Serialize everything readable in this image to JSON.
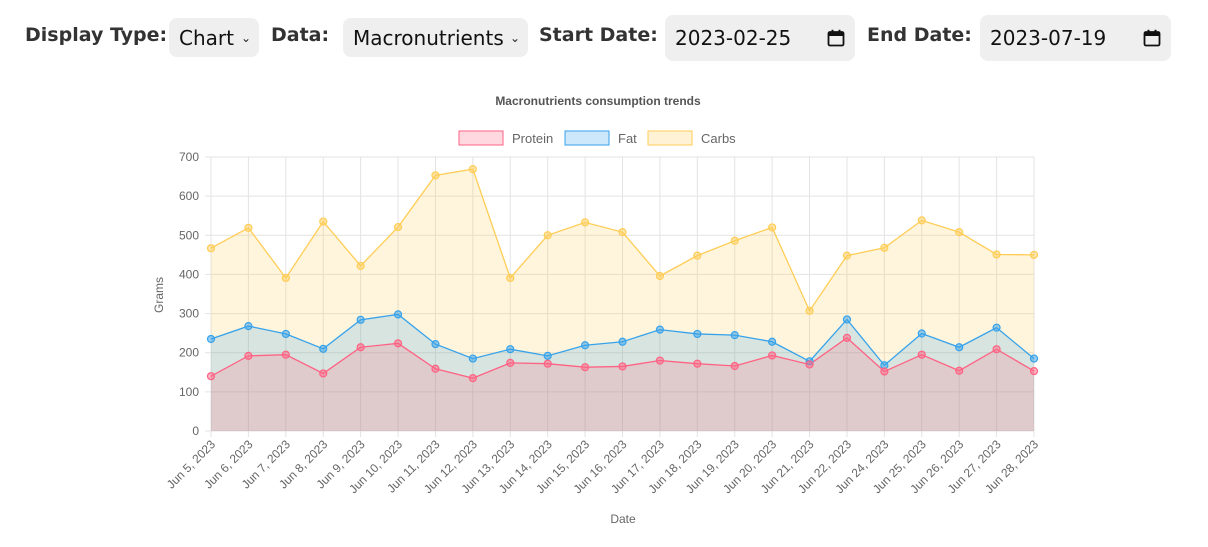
{
  "controls": {
    "display_type_label": "Display Type:",
    "display_type_value": "Chart",
    "data_label": "Data:",
    "data_value": "Macronutrients",
    "start_date_label": "Start Date:",
    "start_date_value": "2023-02-25",
    "end_date_label": "End Date:",
    "end_date_value": "2023-07-19"
  },
  "colors": {
    "protein": "#ff6384",
    "fat": "#36a2eb",
    "carbs": "#ffcd56"
  },
  "chart_data": {
    "type": "area",
    "title": "Macronutrients consumption trends",
    "xlabel": "Date",
    "ylabel": "Grams",
    "ylim": [
      0,
      700
    ],
    "yticks": [
      0,
      100,
      200,
      300,
      400,
      500,
      600,
      700
    ],
    "grid": true,
    "legend_position": "top",
    "categories": [
      "Jun 5, 2023",
      "Jun 6, 2023",
      "Jun 7, 2023",
      "Jun 8, 2023",
      "Jun 9, 2023",
      "Jun 10, 2023",
      "Jun 11, 2023",
      "Jun 12, 2023",
      "Jun 13, 2023",
      "Jun 14, 2023",
      "Jun 15, 2023",
      "Jun 16, 2023",
      "Jun 17, 2023",
      "Jun 18, 2023",
      "Jun 19, 2023",
      "Jun 20, 2023",
      "Jun 21, 2023",
      "Jun 22, 2023",
      "Jun 24, 2023",
      "Jun 25, 2023",
      "Jun 26, 2023",
      "Jun 27, 2023",
      "Jun 28, 2023"
    ],
    "series": [
      {
        "name": "Protein",
        "values": [
          140,
          192,
          195,
          147,
          214,
          224,
          159,
          135,
          174,
          172,
          163,
          165,
          180,
          172,
          166,
          193,
          170,
          238,
          152,
          195,
          154,
          209,
          153
        ]
      },
      {
        "name": "Fat",
        "values": [
          235,
          268,
          248,
          210,
          284,
          298,
          222,
          185,
          209,
          192,
          219,
          228,
          259,
          248,
          245,
          228,
          178,
          285,
          168,
          249,
          214,
          264,
          185
        ]
      },
      {
        "name": "Carbs",
        "values": [
          467,
          519,
          391,
          535,
          422,
          521,
          653,
          669,
          391,
          500,
          533,
          508,
          396,
          448,
          486,
          520,
          307,
          448,
          468,
          538,
          508,
          451,
          450
        ]
      }
    ]
  }
}
